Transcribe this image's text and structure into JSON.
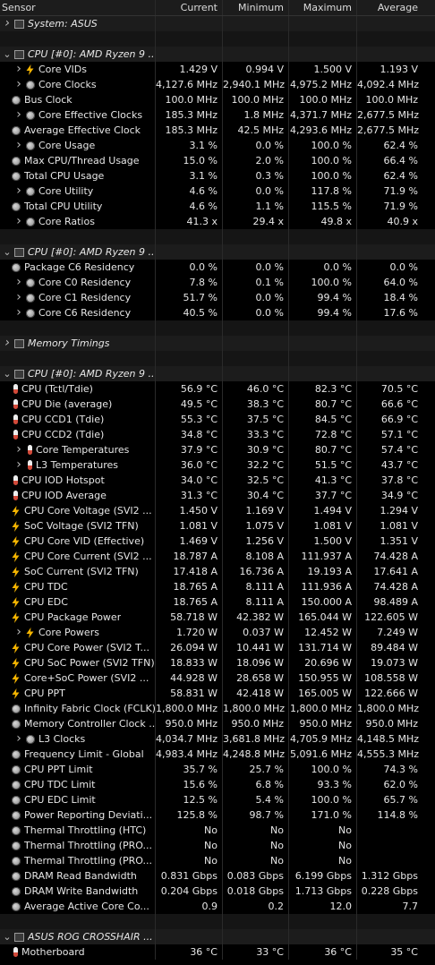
{
  "columns": {
    "sensor": "Sensor",
    "current": "Current",
    "minimum": "Minimum",
    "maximum": "Maximum",
    "average": "Average"
  },
  "rows": [
    {
      "type": "group",
      "expander": ">",
      "icon": "chip-icon",
      "name": "System: ASUS"
    },
    {
      "type": "blank"
    },
    {
      "type": "group",
      "expander": "v",
      "icon": "chip-icon",
      "name": "CPU [#0]: AMD Ryzen 9 ..."
    },
    {
      "type": "data",
      "indent": 1,
      "expander": ">",
      "icon": "bolt-icon",
      "name": "Core VIDs",
      "cur": "1.429 V",
      "min": "0.994 V",
      "max": "1.500 V",
      "avg": "1.193 V"
    },
    {
      "type": "data",
      "indent": 1,
      "expander": ">",
      "icon": "clock-icon",
      "name": "Core Clocks",
      "cur": "4,127.6 MHz",
      "min": "2,940.1 MHz",
      "max": "4,975.2 MHz",
      "avg": "4,092.4 MHz"
    },
    {
      "type": "data",
      "indent": 0,
      "expander": "",
      "icon": "clock-icon",
      "name": "Bus Clock",
      "cur": "100.0 MHz",
      "min": "100.0 MHz",
      "max": "100.0 MHz",
      "avg": "100.0 MHz"
    },
    {
      "type": "data",
      "indent": 1,
      "expander": ">",
      "icon": "clock-icon",
      "name": "Core Effective Clocks",
      "cur": "185.3 MHz",
      "min": "1.8 MHz",
      "max": "4,371.7 MHz",
      "avg": "2,677.5 MHz"
    },
    {
      "type": "data",
      "indent": 0,
      "expander": "",
      "icon": "clock-icon",
      "name": "Average Effective Clock",
      "cur": "185.3 MHz",
      "min": "42.5 MHz",
      "max": "4,293.6 MHz",
      "avg": "2,677.5 MHz"
    },
    {
      "type": "data",
      "indent": 1,
      "expander": ">",
      "icon": "clock-icon",
      "name": "Core Usage",
      "cur": "3.1 %",
      "min": "0.0 %",
      "max": "100.0 %",
      "avg": "62.4 %"
    },
    {
      "type": "data",
      "indent": 0,
      "expander": "",
      "icon": "clock-icon",
      "name": "Max CPU/Thread Usage",
      "cur": "15.0 %",
      "min": "2.0 %",
      "max": "100.0 %",
      "avg": "66.4 %"
    },
    {
      "type": "data",
      "indent": 0,
      "expander": "",
      "icon": "clock-icon",
      "name": "Total CPU Usage",
      "cur": "3.1 %",
      "min": "0.3 %",
      "max": "100.0 %",
      "avg": "62.4 %"
    },
    {
      "type": "data",
      "indent": 1,
      "expander": ">",
      "icon": "clock-icon",
      "name": "Core Utility",
      "cur": "4.6 %",
      "min": "0.0 %",
      "max": "117.8 %",
      "avg": "71.9 %"
    },
    {
      "type": "data",
      "indent": 0,
      "expander": "",
      "icon": "clock-icon",
      "name": "Total CPU Utility",
      "cur": "4.6 %",
      "min": "1.1 %",
      "max": "115.5 %",
      "avg": "71.9 %"
    },
    {
      "type": "data",
      "indent": 1,
      "expander": ">",
      "icon": "clock-icon",
      "name": "Core Ratios",
      "cur": "41.3 x",
      "min": "29.4 x",
      "max": "49.8 x",
      "avg": "40.9 x"
    },
    {
      "type": "blank"
    },
    {
      "type": "group",
      "expander": "v",
      "icon": "chip-icon",
      "name": "CPU [#0]: AMD Ryzen 9 ..."
    },
    {
      "type": "data",
      "indent": 0,
      "expander": "",
      "icon": "clock-icon",
      "name": "Package C6 Residency",
      "cur": "0.0 %",
      "min": "0.0 %",
      "max": "0.0 %",
      "avg": "0.0 %"
    },
    {
      "type": "data",
      "indent": 1,
      "expander": ">",
      "icon": "clock-icon",
      "name": "Core C0 Residency",
      "cur": "7.8 %",
      "min": "0.1 %",
      "max": "100.0 %",
      "avg": "64.0 %"
    },
    {
      "type": "data",
      "indent": 1,
      "expander": ">",
      "icon": "clock-icon",
      "name": "Core C1 Residency",
      "cur": "51.7 %",
      "min": "0.0 %",
      "max": "99.4 %",
      "avg": "18.4 %"
    },
    {
      "type": "data",
      "indent": 1,
      "expander": ">",
      "icon": "clock-icon",
      "name": "Core C6 Residency",
      "cur": "40.5 %",
      "min": "0.0 %",
      "max": "99.4 %",
      "avg": "17.6 %"
    },
    {
      "type": "blank"
    },
    {
      "type": "group",
      "expander": ">",
      "icon": "chip-icon",
      "name": "Memory Timings"
    },
    {
      "type": "blank"
    },
    {
      "type": "group",
      "expander": "v",
      "icon": "chip-icon",
      "name": "CPU [#0]: AMD Ryzen 9 ..."
    },
    {
      "type": "data",
      "indent": 0,
      "expander": "",
      "icon": "thermometer-icon",
      "name": "CPU (Tctl/Tdie)",
      "cur": "56.9 °C",
      "min": "46.0 °C",
      "max": "82.3 °C",
      "avg": "70.5 °C"
    },
    {
      "type": "data",
      "indent": 0,
      "expander": "",
      "icon": "thermometer-icon",
      "name": "CPU Die (average)",
      "cur": "49.5 °C",
      "min": "38.3 °C",
      "max": "80.7 °C",
      "avg": "66.6 °C"
    },
    {
      "type": "data",
      "indent": 0,
      "expander": "",
      "icon": "thermometer-icon",
      "name": "CPU CCD1 (Tdie)",
      "cur": "55.3 °C",
      "min": "37.5 °C",
      "max": "84.5 °C",
      "avg": "66.9 °C"
    },
    {
      "type": "data",
      "indent": 0,
      "expander": "",
      "icon": "thermometer-icon",
      "name": "CPU CCD2 (Tdie)",
      "cur": "34.8 °C",
      "min": "33.3 °C",
      "max": "72.8 °C",
      "avg": "57.1 °C"
    },
    {
      "type": "data",
      "indent": 1,
      "expander": ">",
      "icon": "thermometer-icon",
      "name": "Core Temperatures",
      "cur": "37.9 °C",
      "min": "30.9 °C",
      "max": "80.7 °C",
      "avg": "57.4 °C"
    },
    {
      "type": "data",
      "indent": 1,
      "expander": ">",
      "icon": "thermometer-icon",
      "name": "L3 Temperatures",
      "cur": "36.0 °C",
      "min": "32.2 °C",
      "max": "51.5 °C",
      "avg": "43.7 °C"
    },
    {
      "type": "data",
      "indent": 0,
      "expander": "",
      "icon": "thermometer-icon",
      "name": "CPU IOD Hotspot",
      "cur": "34.0 °C",
      "min": "32.5 °C",
      "max": "41.3 °C",
      "avg": "37.8 °C"
    },
    {
      "type": "data",
      "indent": 0,
      "expander": "",
      "icon": "thermometer-icon",
      "name": "CPU IOD Average",
      "cur": "31.3 °C",
      "min": "30.4 °C",
      "max": "37.7 °C",
      "avg": "34.9 °C"
    },
    {
      "type": "data",
      "indent": 0,
      "expander": "",
      "icon": "bolt-icon",
      "name": "CPU Core Voltage (SVI2 ...",
      "cur": "1.450 V",
      "min": "1.169 V",
      "max": "1.494 V",
      "avg": "1.294 V"
    },
    {
      "type": "data",
      "indent": 0,
      "expander": "",
      "icon": "bolt-icon",
      "name": "SoC Voltage (SVI2 TFN)",
      "cur": "1.081 V",
      "min": "1.075 V",
      "max": "1.081 V",
      "avg": "1.081 V"
    },
    {
      "type": "data",
      "indent": 0,
      "expander": "",
      "icon": "bolt-icon",
      "name": "CPU Core VID (Effective)",
      "cur": "1.469 V",
      "min": "1.256 V",
      "max": "1.500 V",
      "avg": "1.351 V"
    },
    {
      "type": "data",
      "indent": 0,
      "expander": "",
      "icon": "bolt-icon",
      "name": "CPU Core Current (SVI2 ...",
      "cur": "18.787 A",
      "min": "8.108 A",
      "max": "111.937 A",
      "avg": "74.428 A"
    },
    {
      "type": "data",
      "indent": 0,
      "expander": "",
      "icon": "bolt-icon",
      "name": "SoC Current (SVI2 TFN)",
      "cur": "17.418 A",
      "min": "16.736 A",
      "max": "19.193 A",
      "avg": "17.641 A"
    },
    {
      "type": "data",
      "indent": 0,
      "expander": "",
      "icon": "bolt-icon",
      "name": "CPU TDC",
      "cur": "18.765 A",
      "min": "8.111 A",
      "max": "111.936 A",
      "avg": "74.428 A"
    },
    {
      "type": "data",
      "indent": 0,
      "expander": "",
      "icon": "bolt-icon",
      "name": "CPU EDC",
      "cur": "18.765 A",
      "min": "8.111 A",
      "max": "150.000 A",
      "avg": "98.489 A"
    },
    {
      "type": "data",
      "indent": 0,
      "expander": "",
      "icon": "bolt-icon",
      "name": "CPU Package Power",
      "cur": "58.718 W",
      "min": "42.382 W",
      "max": "165.044 W",
      "avg": "122.605 W"
    },
    {
      "type": "data",
      "indent": 1,
      "expander": ">",
      "icon": "bolt-icon",
      "name": "Core Powers",
      "cur": "1.720 W",
      "min": "0.037 W",
      "max": "12.452 W",
      "avg": "7.249 W"
    },
    {
      "type": "data",
      "indent": 0,
      "expander": "",
      "icon": "bolt-icon",
      "name": "CPU Core Power (SVI2 T...",
      "cur": "26.094 W",
      "min": "10.441 W",
      "max": "131.714 W",
      "avg": "89.484 W"
    },
    {
      "type": "data",
      "indent": 0,
      "expander": "",
      "icon": "bolt-icon",
      "name": "CPU SoC Power (SVI2 TFN)",
      "cur": "18.833 W",
      "min": "18.096 W",
      "max": "20.696 W",
      "avg": "19.073 W"
    },
    {
      "type": "data",
      "indent": 0,
      "expander": "",
      "icon": "bolt-icon",
      "name": "Core+SoC Power (SVI2 ...",
      "cur": "44.928 W",
      "min": "28.658 W",
      "max": "150.955 W",
      "avg": "108.558 W"
    },
    {
      "type": "data",
      "indent": 0,
      "expander": "",
      "icon": "bolt-icon",
      "name": "CPU PPT",
      "cur": "58.831 W",
      "min": "42.418 W",
      "max": "165.005 W",
      "avg": "122.666 W"
    },
    {
      "type": "data",
      "indent": 0,
      "expander": "",
      "icon": "clock-icon",
      "name": "Infinity Fabric Clock (FCLK)",
      "cur": "1,800.0 MHz",
      "min": "1,800.0 MHz",
      "max": "1,800.0 MHz",
      "avg": "1,800.0 MHz"
    },
    {
      "type": "data",
      "indent": 0,
      "expander": "",
      "icon": "clock-icon",
      "name": "Memory Controller Clock ...",
      "cur": "950.0 MHz",
      "min": "950.0 MHz",
      "max": "950.0 MHz",
      "avg": "950.0 MHz"
    },
    {
      "type": "data",
      "indent": 1,
      "expander": ">",
      "icon": "clock-icon",
      "name": "L3 Clocks",
      "cur": "4,034.7 MHz",
      "min": "3,681.8 MHz",
      "max": "4,705.9 MHz",
      "avg": "4,148.5 MHz"
    },
    {
      "type": "data",
      "indent": 0,
      "expander": "",
      "icon": "clock-icon",
      "name": "Frequency Limit - Global",
      "cur": "4,983.4 MHz",
      "min": "4,248.8 MHz",
      "max": "5,091.6 MHz",
      "avg": "4,555.3 MHz"
    },
    {
      "type": "data",
      "indent": 0,
      "expander": "",
      "icon": "clock-icon",
      "name": "CPU PPT Limit",
      "cur": "35.7 %",
      "min": "25.7 %",
      "max": "100.0 %",
      "avg": "74.3 %"
    },
    {
      "type": "data",
      "indent": 0,
      "expander": "",
      "icon": "clock-icon",
      "name": "CPU TDC Limit",
      "cur": "15.6 %",
      "min": "6.8 %",
      "max": "93.3 %",
      "avg": "62.0 %"
    },
    {
      "type": "data",
      "indent": 0,
      "expander": "",
      "icon": "clock-icon",
      "name": "CPU EDC Limit",
      "cur": "12.5 %",
      "min": "5.4 %",
      "max": "100.0 %",
      "avg": "65.7 %"
    },
    {
      "type": "data",
      "indent": 0,
      "expander": "",
      "icon": "clock-icon",
      "name": "Power Reporting Deviati...",
      "cur": "125.8 %",
      "min": "98.7 %",
      "max": "171.0 %",
      "avg": "114.8 %"
    },
    {
      "type": "data",
      "indent": 0,
      "expander": "",
      "icon": "clock-icon",
      "name": "Thermal Throttling (HTC)",
      "cur": "No",
      "min": "No",
      "max": "No",
      "avg": ""
    },
    {
      "type": "data",
      "indent": 0,
      "expander": "",
      "icon": "clock-icon",
      "name": "Thermal Throttling (PRO...",
      "cur": "No",
      "min": "No",
      "max": "No",
      "avg": ""
    },
    {
      "type": "data",
      "indent": 0,
      "expander": "",
      "icon": "clock-icon",
      "name": "Thermal Throttling (PRO...",
      "cur": "No",
      "min": "No",
      "max": "No",
      "avg": ""
    },
    {
      "type": "data",
      "indent": 0,
      "expander": "",
      "icon": "clock-icon",
      "name": "DRAM Read Bandwidth",
      "cur": "0.831 Gbps",
      "min": "0.083 Gbps",
      "max": "6.199 Gbps",
      "avg": "1.312 Gbps"
    },
    {
      "type": "data",
      "indent": 0,
      "expander": "",
      "icon": "clock-icon",
      "name": "DRAM Write Bandwidth",
      "cur": "0.204 Gbps",
      "min": "0.018 Gbps",
      "max": "1.713 Gbps",
      "avg": "0.228 Gbps"
    },
    {
      "type": "data",
      "indent": 0,
      "expander": "",
      "icon": "clock-icon",
      "name": "Average Active Core Co...",
      "cur": "0.9",
      "min": "0.2",
      "max": "12.0",
      "avg": "7.7"
    },
    {
      "type": "blank"
    },
    {
      "type": "group",
      "expander": "v",
      "icon": "chip-icon",
      "name": "ASUS ROG CROSSHAIR ..."
    },
    {
      "type": "data",
      "indent": 0,
      "expander": "",
      "icon": "thermometer-icon",
      "name": "Motherboard",
      "cur": "36 °C",
      "min": "33 °C",
      "max": "36 °C",
      "avg": "35 °C"
    }
  ],
  "colors": {
    "bolt": "#f4b400",
    "background": "#000000",
    "header": "#1c1c1c"
  }
}
